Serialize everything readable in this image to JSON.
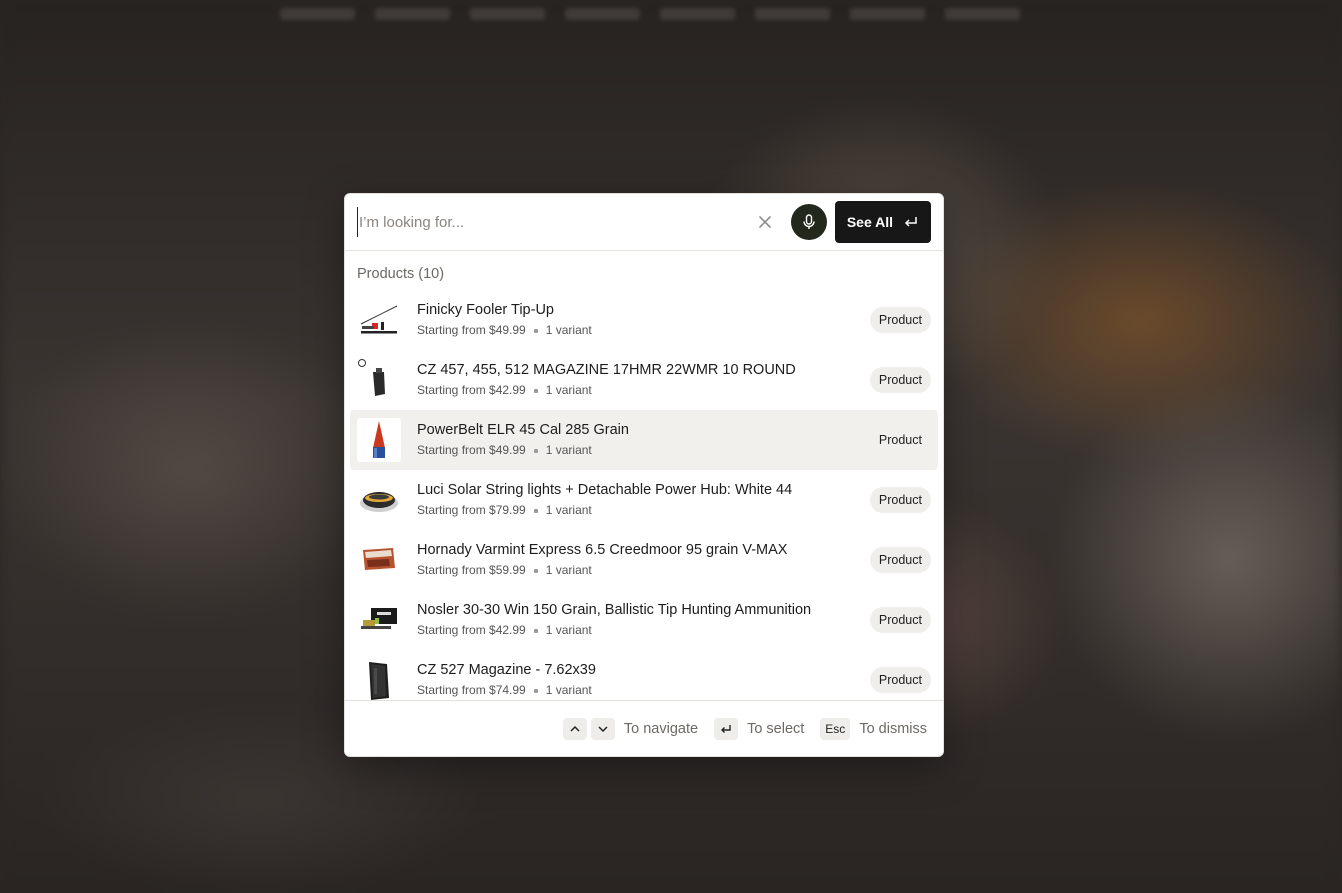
{
  "search": {
    "placeholder": "I’m looking for...",
    "see_all_label": "See All"
  },
  "products": {
    "section_title": "Products (10)",
    "items": [
      {
        "title": "Finicky Fooler Tip-Up",
        "price": "Starting from $49.99",
        "variants": "1 variant",
        "badge": "Product"
      },
      {
        "title": "CZ 457, 455, 512 MAGAZINE 17HMR 22WMR 10 ROUND",
        "price": "Starting from $42.99",
        "variants": "1 variant",
        "badge": "Product"
      },
      {
        "title": "PowerBelt ELR 45 Cal 285 Grain",
        "price": "Starting from $49.99",
        "variants": "1 variant",
        "badge": "Product"
      },
      {
        "title": "Luci Solar String lights + Detachable Power Hub: White 44",
        "price": "Starting from $79.99",
        "variants": "1 variant",
        "badge": "Product"
      },
      {
        "title": "Hornady Varmint Express 6.5 Creedmoor 95 grain V-MAX",
        "price": "Starting from $59.99",
        "variants": "1 variant",
        "badge": "Product"
      },
      {
        "title": "Nosler 30-30 Win 150 Grain, Ballistic Tip Hunting Ammunition",
        "price": "Starting from $42.99",
        "variants": "1 variant",
        "badge": "Product"
      },
      {
        "title": "CZ 527 Magazine - 7.62x39",
        "price": "Starting from $74.99",
        "variants": "1 variant",
        "badge": "Product"
      }
    ]
  },
  "footer": {
    "navigate_hint": "To navigate",
    "select_hint": "To select",
    "esc_key": "Esc",
    "dismiss_hint": "To dismiss"
  },
  "colors": {
    "mic_button": "#22291c",
    "see_all_button": "#171717",
    "active_row": "#f1f0ed"
  }
}
